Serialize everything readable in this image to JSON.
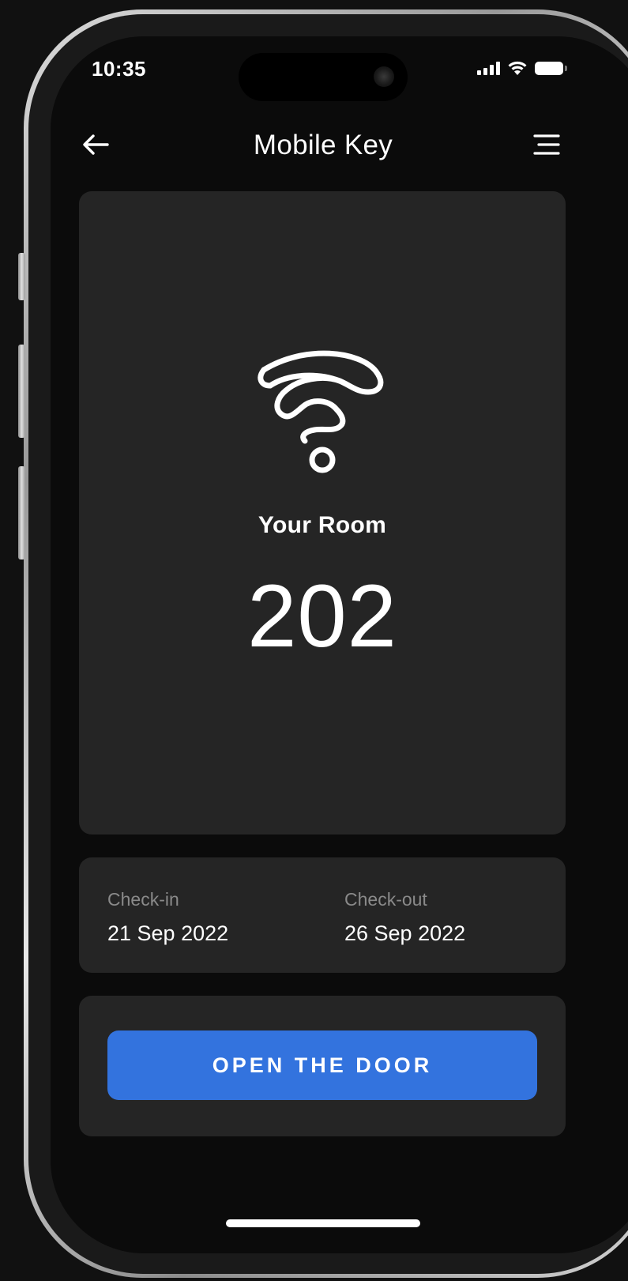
{
  "status_bar": {
    "time": "10:35",
    "icons": [
      "cellular-signal-icon",
      "wifi-icon",
      "battery-icon"
    ]
  },
  "header": {
    "title": "Mobile Key",
    "back_icon": "arrow-left-icon",
    "menu_icon": "menu-icon"
  },
  "room": {
    "icon": "nfc-icon",
    "label": "Your Room",
    "number": "202"
  },
  "stay": {
    "check_in_label": "Check-in",
    "check_in_date": "21 Sep 2022",
    "check_out_label": "Check-out",
    "check_out_date": "26 Sep 2022"
  },
  "action": {
    "open_door_label": "OPEN THE DOOR"
  },
  "colors": {
    "background": "#0b0b0b",
    "card": "#252525",
    "accent": "#3373de",
    "text_primary": "#ffffff",
    "text_secondary": "#8a8a8a"
  }
}
